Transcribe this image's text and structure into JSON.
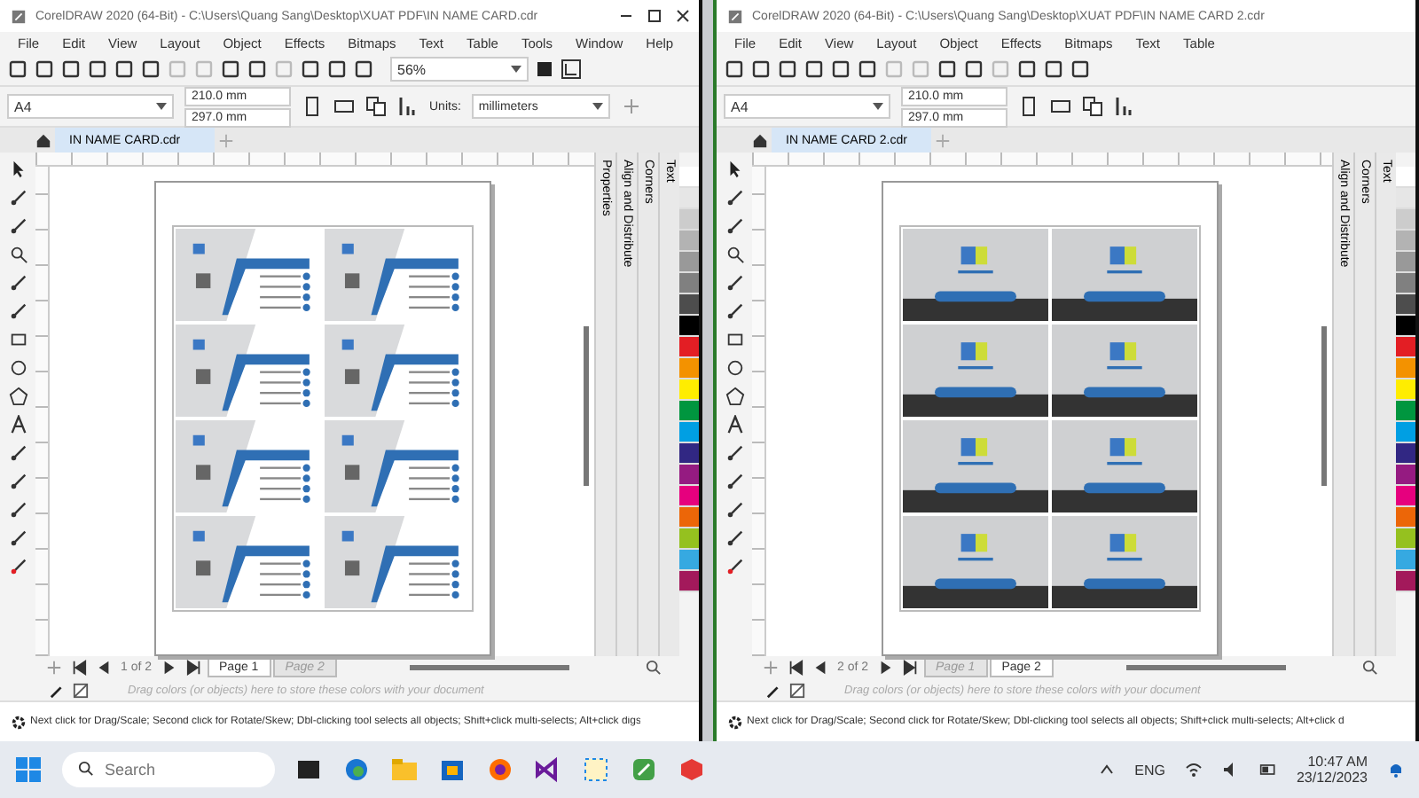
{
  "windows": [
    {
      "title": "CorelDRAW 2020 (64-Bit) - C:\\Users\\Quang Sang\\Desktop\\XUAT PDF\\IN NAME CARD.cdr",
      "menu": [
        "File",
        "Edit",
        "View",
        "Layout",
        "Object",
        "Effects",
        "Bitmaps",
        "Text",
        "Table",
        "Tools",
        "Window",
        "Help"
      ],
      "zoom": "56%",
      "paper": "A4",
      "page_width": "210.0 mm",
      "page_height": "297.0 mm",
      "units_label": "Units:",
      "units": "millimeters",
      "doc_tab": "IN NAME CARD.cdr",
      "dockers": [
        "Properties",
        "Align and Distribute",
        "Corners",
        "Text"
      ],
      "kind": "front",
      "page_nav": "1 of 2",
      "pages": [
        {
          "label": "Page 1",
          "selected": true
        },
        {
          "label": "Page 2",
          "selected": false
        }
      ],
      "palette_hint": "Drag colors (or objects) here to store these colors with your document",
      "status": "Next click for Drag/Scale; Second click for Rotate/Skew; Dbl-clicking tool selects all objects; Shift+click multi-selects; Alt+click digs"
    },
    {
      "title": "CorelDRAW 2020 (64-Bit) - C:\\Users\\Quang Sang\\Desktop\\XUAT PDF\\IN NAME CARD 2.cdr",
      "menu": [
        "File",
        "Edit",
        "View",
        "Layout",
        "Object",
        "Effects",
        "Bitmaps",
        "Text",
        "Table"
      ],
      "paper": "A4",
      "page_width": "210.0 mm",
      "page_height": "297.0 mm",
      "doc_tab": "IN NAME CARD 2.cdr",
      "dockers": [
        "Align and Distribute",
        "Corners",
        "Text"
      ],
      "kind": "back",
      "page_nav": "2 of 2",
      "pages": [
        {
          "label": "Page 1",
          "selected": false
        },
        {
          "label": "Page 2",
          "selected": true
        }
      ],
      "palette_hint": "Drag colors (or objects) here to store these colors with your document",
      "status": "Next click for Drag/Scale; Second click for Rotate/Skew; Dbl-clicking tool selects all objects; Shift+click multi-selects; Alt+click d"
    }
  ],
  "taskbar": {
    "search_placeholder": "Search",
    "language": "ENG",
    "time": "10:47 AM",
    "date": "23/12/2023"
  }
}
